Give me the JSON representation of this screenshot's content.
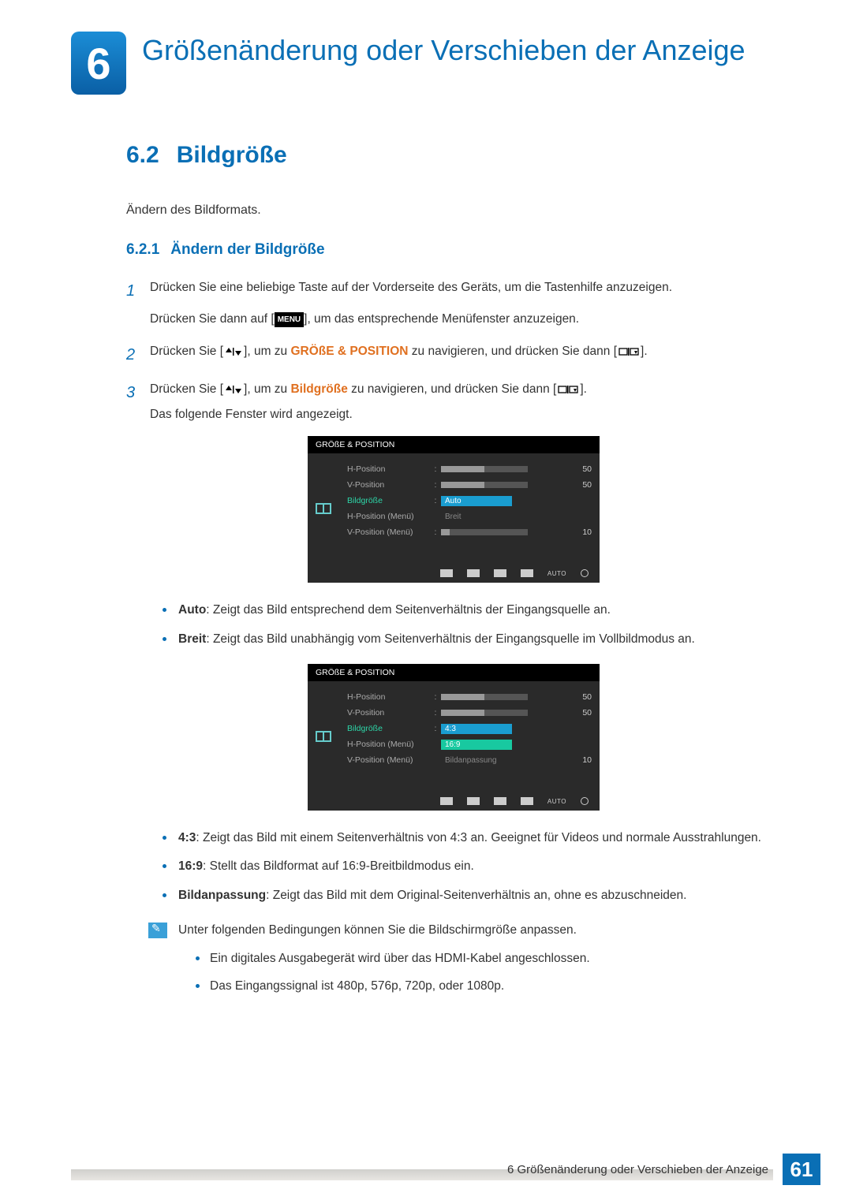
{
  "chapter": {
    "number": "6",
    "title": "Größenänderung oder Verschieben der Anzeige"
  },
  "section": {
    "number": "6.2",
    "title": "Bildgröße",
    "intro": "Ändern des Bildformats."
  },
  "subsection": {
    "number": "6.2.1",
    "title": "Ändern der Bildgröße"
  },
  "steps": [
    {
      "num": "1",
      "line1_a": "Drücken Sie eine beliebige Taste auf der Vorderseite des Geräts, um die Tastenhilfe anzuzeigen.",
      "line2_a": "Drücken Sie dann auf [",
      "line2_menu": "MENU",
      "line2_b": "], um das entsprechende Menüfenster anzuzeigen."
    },
    {
      "num": "2",
      "line1_a": "Drücken Sie [",
      "line1_b": "], um zu ",
      "line1_orange": "GRÖßE & POSITION",
      "line1_c": " zu navigieren, und drücken Sie dann [",
      "line1_d": "]."
    },
    {
      "num": "3",
      "line1_a": "Drücken Sie [",
      "line1_b": "], um zu ",
      "line1_orange": "Bildgröße",
      "line1_c": " zu navigieren, und drücken Sie dann [",
      "line1_d": "].",
      "line2": "Das folgende Fenster wird angezeigt."
    }
  ],
  "osd1": {
    "title": "GRÖßE & POSITION",
    "rows": {
      "hpos": "H-Position",
      "vpos": "V-Position",
      "size": "Bildgröße",
      "hmenu": "H-Position (Menü)",
      "vmenu": "V-Position (Menü)"
    },
    "vals": {
      "hpos": "50",
      "vpos": "50",
      "vmenu": "10"
    },
    "opts": {
      "auto": "Auto",
      "breit": "Breit"
    },
    "footer_auto": "AUTO"
  },
  "osd2": {
    "title": "GRÖßE & POSITION",
    "rows": {
      "hpos": "H-Position",
      "vpos": "V-Position",
      "size": "Bildgröße",
      "hmenu": "H-Position (Menü)",
      "vmenu": "V-Position (Menü)"
    },
    "vals": {
      "hpos": "50",
      "vpos": "50",
      "vmenu": "10"
    },
    "opts": {
      "r43": "4:3",
      "r169": "16:9",
      "fit": "Bildanpassung"
    },
    "footer_auto": "AUTO"
  },
  "bullets1": [
    {
      "term": "Auto",
      "desc": ": Zeigt das Bild entsprechend dem Seitenverhältnis der Eingangsquelle an."
    },
    {
      "term": "Breit",
      "desc": ": Zeigt das Bild unabhängig vom Seitenverhältnis der Eingangsquelle im Vollbildmodus an."
    }
  ],
  "bullets2": [
    {
      "term": "4:3",
      "desc": ": Zeigt das Bild mit einem Seitenverhältnis von 4:3 an. Geeignet für Videos und normale Ausstrahlungen."
    },
    {
      "term": "16:9",
      "desc": ": Stellt das Bildformat auf 16:9-Breitbildmodus ein."
    },
    {
      "term": "Bildanpassung",
      "desc": ": Zeigt das Bild mit dem Original-Seitenverhältnis an, ohne es abzuschneiden."
    }
  ],
  "note": {
    "intro": "Unter folgenden Bedingungen können Sie die Bildschirmgröße anpassen.",
    "items": [
      "Ein digitales Ausgabegerät wird über das HDMI-Kabel angeschlossen.",
      "Das Eingangssignal ist 480p, 576p, 720p, oder 1080p."
    ]
  },
  "footer": {
    "label": "6 Größenänderung oder Verschieben der Anzeige",
    "page": "61"
  }
}
